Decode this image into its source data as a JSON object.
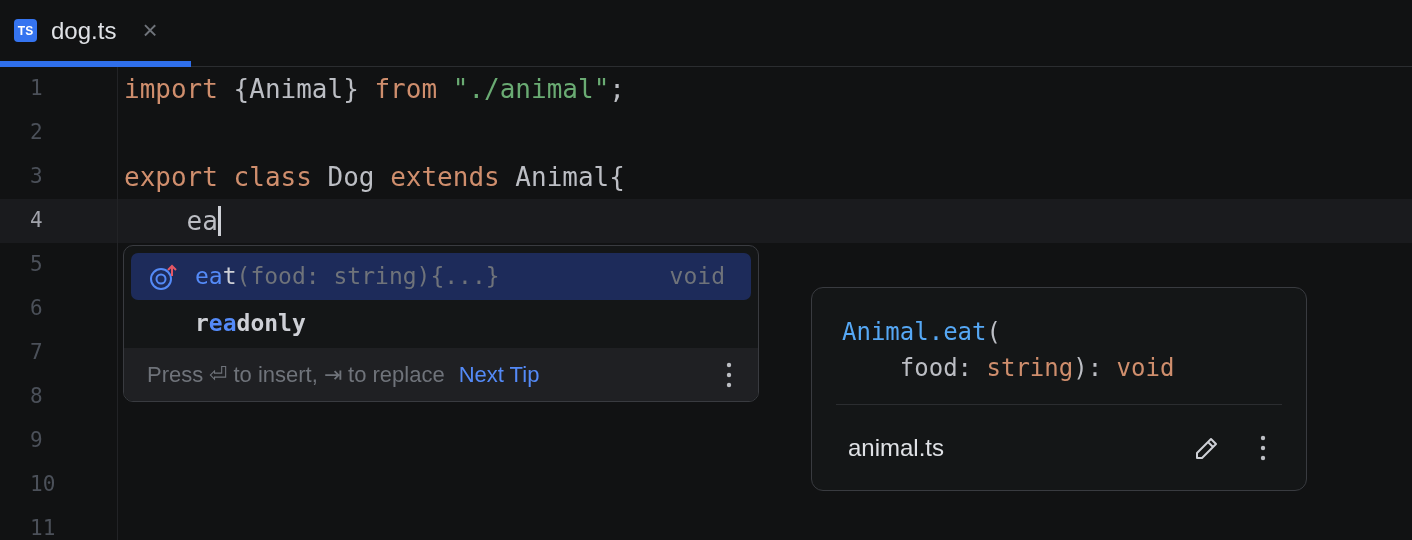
{
  "tab": {
    "badge": "TS",
    "title": "dog.ts",
    "close": "×",
    "selected": true
  },
  "lines": [
    {
      "number": "1",
      "current": false,
      "tokens": [
        {
          "kind": "keyword",
          "text": "import"
        },
        {
          "kind": "plain",
          "text": " {Animal} "
        },
        {
          "kind": "keyword",
          "text": "from "
        },
        {
          "kind": "string",
          "text": "\"./animal\""
        },
        {
          "kind": "plain",
          "text": ";"
        }
      ]
    },
    {
      "number": "2",
      "current": false
    },
    {
      "number": "3",
      "current": false,
      "tokens": [
        {
          "kind": "keyword",
          "text": "export class"
        },
        {
          "kind": "plain",
          "text": " Dog "
        },
        {
          "kind": "keyword",
          "text": "extends"
        },
        {
          "kind": "plain",
          "text": " Animal{"
        }
      ]
    },
    {
      "number": "4",
      "current": true,
      "tokens": [
        {
          "kind": "plain",
          "text": "    ea"
        }
      ]
    },
    {
      "number": "5",
      "current": false
    },
    {
      "number": "6",
      "current": false
    },
    {
      "number": "7",
      "current": false
    },
    {
      "number": "8",
      "current": false
    },
    {
      "number": "9",
      "current": false
    },
    {
      "number": "10",
      "current": false
    },
    {
      "number": "11",
      "current": false
    }
  ],
  "completion": {
    "items": [
      {
        "kind": "method",
        "selected": true,
        "bold": false,
        "segments": [
          {
            "text": "ea",
            "match": true
          },
          {
            "text": "t",
            "match": false
          }
        ],
        "tail": "(food: string){...}",
        "type": "void"
      },
      {
        "kind": "keyword",
        "selected": false,
        "bold": true,
        "segments": [
          {
            "text": "r",
            "match": false
          },
          {
            "text": "ea",
            "match": true
          },
          {
            "text": "donly",
            "match": false
          }
        ]
      }
    ],
    "hint": "Press ⏎ to insert, ⇥ to replace",
    "next_tip": "Next Tip"
  },
  "doc": {
    "signature": [
      [
        {
          "kind": "name",
          "text": "Animal.eat"
        },
        {
          "kind": "plain",
          "text": "("
        }
      ],
      [
        {
          "kind": "plain",
          "text": "    food: "
        },
        {
          "kind": "keyword",
          "text": "string"
        },
        {
          "kind": "plain",
          "text": "): "
        },
        {
          "kind": "keyword",
          "text": "void"
        }
      ]
    ],
    "file": "animal.ts"
  }
}
